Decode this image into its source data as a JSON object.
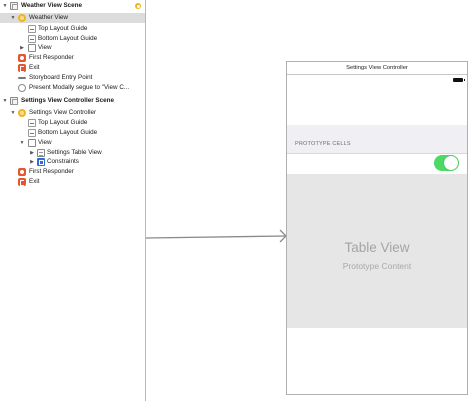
{
  "outline": {
    "warning_icon": "warning-icon",
    "rows": [
      {
        "label": "Weather View Scene",
        "icon": "scene-icon",
        "disclosure": "▼"
      },
      {
        "label": "Weather View",
        "icon": "view-controller-icon",
        "disclosure": "▼"
      },
      {
        "label": "Top Layout Guide",
        "icon": "layout-guide-icon",
        "disclosure": ""
      },
      {
        "label": "Bottom Layout Guide",
        "icon": "layout-guide-icon",
        "disclosure": ""
      },
      {
        "label": "View",
        "icon": "view-icon",
        "disclosure": "▶"
      },
      {
        "label": "First Responder",
        "icon": "first-responder-icon",
        "disclosure": ""
      },
      {
        "label": "Exit",
        "icon": "exit-icon",
        "disclosure": ""
      },
      {
        "label": "Storyboard Entry Point",
        "icon": "entry-point-icon",
        "disclosure": ""
      },
      {
        "label": "Present Modally segue to \"View C...",
        "icon": "segue-icon",
        "disclosure": ""
      },
      {
        "label": "Settings View Controller Scene",
        "icon": "scene-icon",
        "disclosure": "▼"
      },
      {
        "label": "Settings View Controller",
        "icon": "view-controller-icon",
        "disclosure": "▼"
      },
      {
        "label": "Top Layout Guide",
        "icon": "layout-guide-icon",
        "disclosure": ""
      },
      {
        "label": "Bottom Layout Guide",
        "icon": "layout-guide-icon",
        "disclosure": ""
      },
      {
        "label": "View",
        "icon": "view-icon",
        "disclosure": "▼"
      },
      {
        "label": "Settings Table View",
        "icon": "table-view-icon",
        "disclosure": "▶"
      },
      {
        "label": "Constraints",
        "icon": "constraints-icon",
        "disclosure": "▶"
      },
      {
        "label": "First Responder",
        "icon": "first-responder-icon",
        "disclosure": ""
      },
      {
        "label": "Exit",
        "icon": "exit-icon",
        "disclosure": ""
      }
    ]
  },
  "canvas": {
    "nav_title": "Settings View Controller",
    "section_header": "PROTOTYPE CELLS",
    "switch_state": "on",
    "switch_color": "#4cd964",
    "table_title": "Table View",
    "table_subtitle": "Prototype Content"
  }
}
